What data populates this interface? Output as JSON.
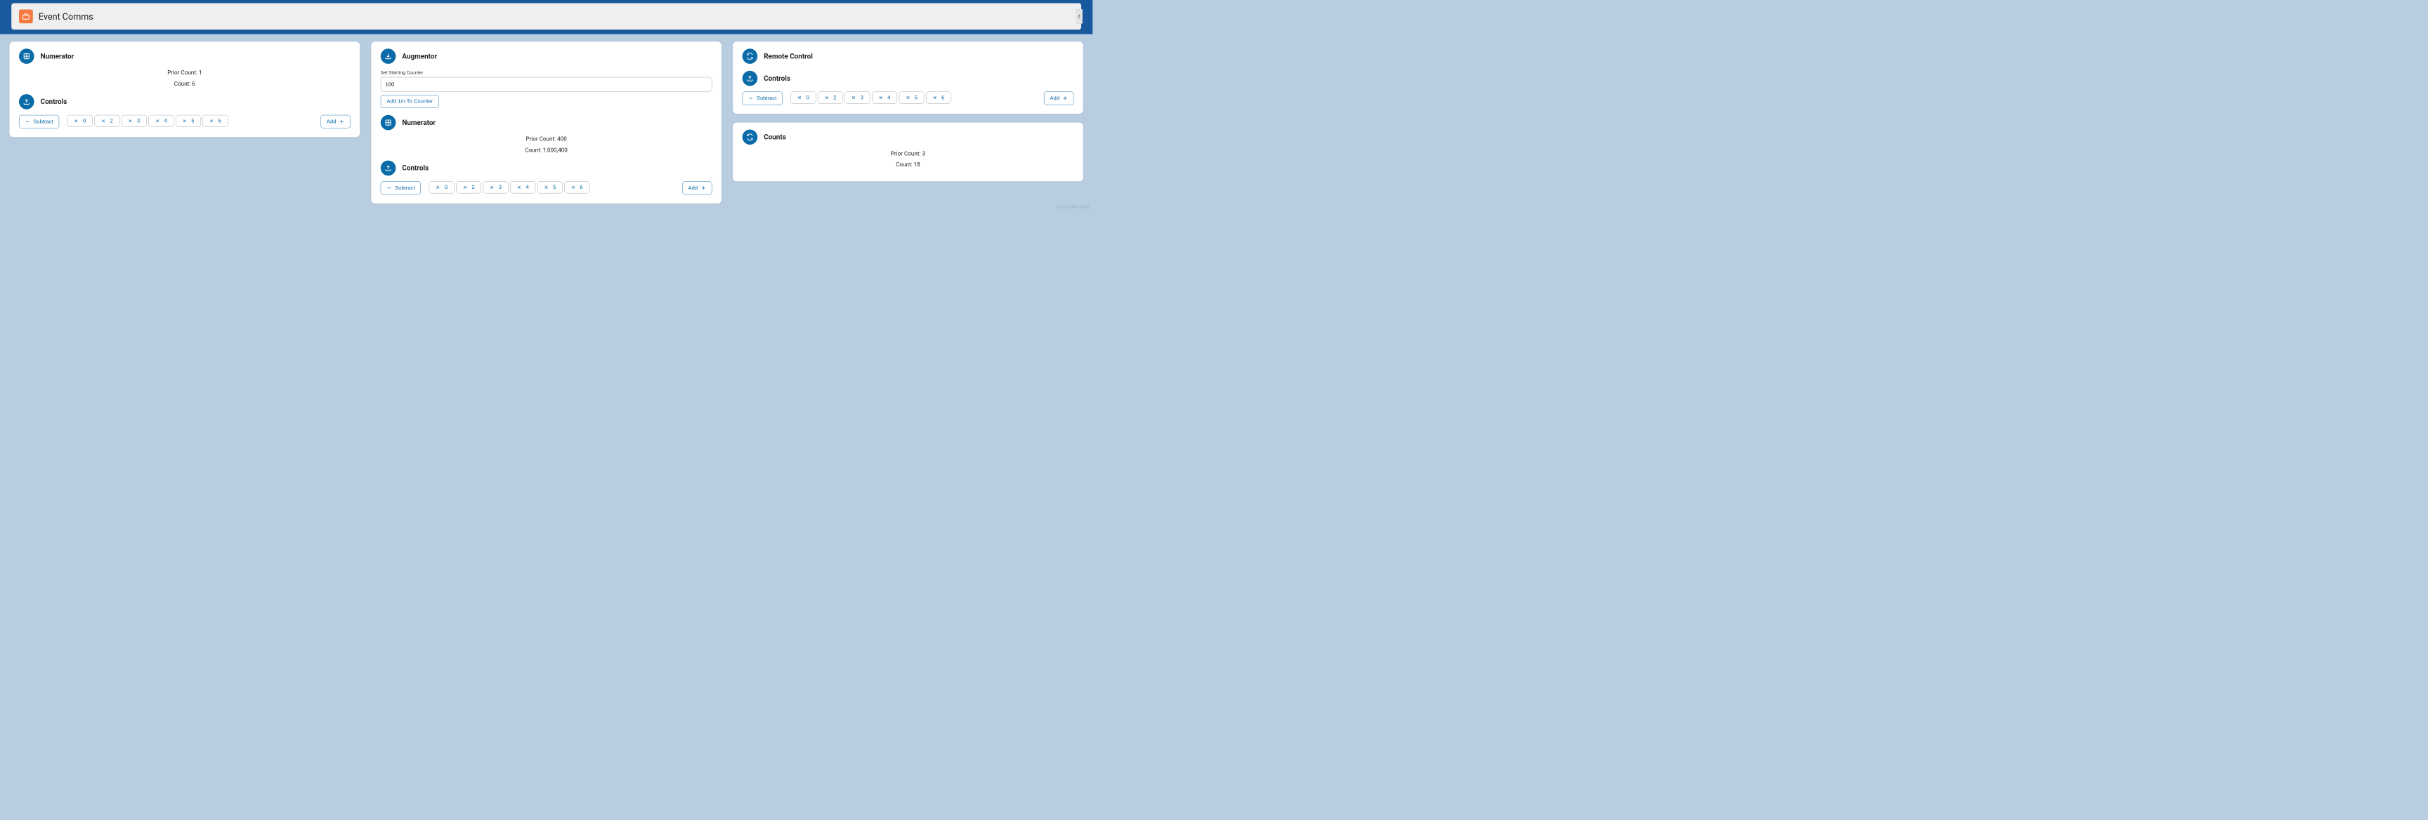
{
  "header": {
    "title": "Event Comms"
  },
  "labels": {
    "prior_count": "Prior Count:",
    "count": "Count:",
    "subtract": "Subtract",
    "add": "Add",
    "controls": "Controls",
    "numerator": "Numerator",
    "augmentor": "Augmentor",
    "remote_control": "Remote Control",
    "counts": "Counts",
    "set_starting_counter": "Set Starting Counter",
    "add_1m": "Add 1m To Counter"
  },
  "col1": {
    "numerator": {
      "prior_count": "1",
      "count": "6"
    },
    "controls": {
      "chips": [
        "0",
        "2",
        "3",
        "4",
        "5",
        "6"
      ]
    }
  },
  "col2": {
    "augmentor": {
      "input_value": "100"
    },
    "numerator": {
      "prior_count": "400",
      "count": "1,000,400"
    },
    "controls": {
      "chips": [
        "0",
        "2",
        "3",
        "4",
        "5",
        "6"
      ]
    }
  },
  "col3": {
    "controls": {
      "chips": [
        "0",
        "2",
        "3",
        "4",
        "5",
        "6"
      ]
    },
    "counts": {
      "prior_count": "3",
      "count": "18"
    }
  },
  "watermark": "CSDN @xRuthless"
}
